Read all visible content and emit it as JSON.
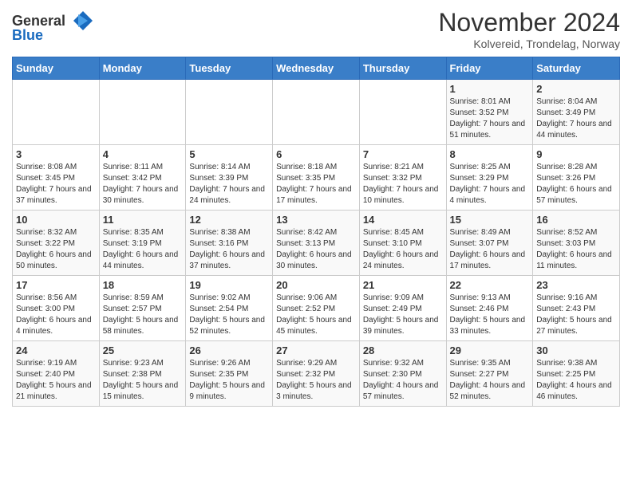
{
  "header": {
    "logo_general": "General",
    "logo_blue": "Blue",
    "month_title": "November 2024",
    "subtitle": "Kolvereid, Trondelag, Norway"
  },
  "weekdays": [
    "Sunday",
    "Monday",
    "Tuesday",
    "Wednesday",
    "Thursday",
    "Friday",
    "Saturday"
  ],
  "weeks": [
    [
      {
        "day": "",
        "info": ""
      },
      {
        "day": "",
        "info": ""
      },
      {
        "day": "",
        "info": ""
      },
      {
        "day": "",
        "info": ""
      },
      {
        "day": "",
        "info": ""
      },
      {
        "day": "1",
        "info": "Sunrise: 8:01 AM\nSunset: 3:52 PM\nDaylight: 7 hours and 51 minutes."
      },
      {
        "day": "2",
        "info": "Sunrise: 8:04 AM\nSunset: 3:49 PM\nDaylight: 7 hours and 44 minutes."
      }
    ],
    [
      {
        "day": "3",
        "info": "Sunrise: 8:08 AM\nSunset: 3:45 PM\nDaylight: 7 hours and 37 minutes."
      },
      {
        "day": "4",
        "info": "Sunrise: 8:11 AM\nSunset: 3:42 PM\nDaylight: 7 hours and 30 minutes."
      },
      {
        "day": "5",
        "info": "Sunrise: 8:14 AM\nSunset: 3:39 PM\nDaylight: 7 hours and 24 minutes."
      },
      {
        "day": "6",
        "info": "Sunrise: 8:18 AM\nSunset: 3:35 PM\nDaylight: 7 hours and 17 minutes."
      },
      {
        "day": "7",
        "info": "Sunrise: 8:21 AM\nSunset: 3:32 PM\nDaylight: 7 hours and 10 minutes."
      },
      {
        "day": "8",
        "info": "Sunrise: 8:25 AM\nSunset: 3:29 PM\nDaylight: 7 hours and 4 minutes."
      },
      {
        "day": "9",
        "info": "Sunrise: 8:28 AM\nSunset: 3:26 PM\nDaylight: 6 hours and 57 minutes."
      }
    ],
    [
      {
        "day": "10",
        "info": "Sunrise: 8:32 AM\nSunset: 3:22 PM\nDaylight: 6 hours and 50 minutes."
      },
      {
        "day": "11",
        "info": "Sunrise: 8:35 AM\nSunset: 3:19 PM\nDaylight: 6 hours and 44 minutes."
      },
      {
        "day": "12",
        "info": "Sunrise: 8:38 AM\nSunset: 3:16 PM\nDaylight: 6 hours and 37 minutes."
      },
      {
        "day": "13",
        "info": "Sunrise: 8:42 AM\nSunset: 3:13 PM\nDaylight: 6 hours and 30 minutes."
      },
      {
        "day": "14",
        "info": "Sunrise: 8:45 AM\nSunset: 3:10 PM\nDaylight: 6 hours and 24 minutes."
      },
      {
        "day": "15",
        "info": "Sunrise: 8:49 AM\nSunset: 3:07 PM\nDaylight: 6 hours and 17 minutes."
      },
      {
        "day": "16",
        "info": "Sunrise: 8:52 AM\nSunset: 3:03 PM\nDaylight: 6 hours and 11 minutes."
      }
    ],
    [
      {
        "day": "17",
        "info": "Sunrise: 8:56 AM\nSunset: 3:00 PM\nDaylight: 6 hours and 4 minutes."
      },
      {
        "day": "18",
        "info": "Sunrise: 8:59 AM\nSunset: 2:57 PM\nDaylight: 5 hours and 58 minutes."
      },
      {
        "day": "19",
        "info": "Sunrise: 9:02 AM\nSunset: 2:54 PM\nDaylight: 5 hours and 52 minutes."
      },
      {
        "day": "20",
        "info": "Sunrise: 9:06 AM\nSunset: 2:52 PM\nDaylight: 5 hours and 45 minutes."
      },
      {
        "day": "21",
        "info": "Sunrise: 9:09 AM\nSunset: 2:49 PM\nDaylight: 5 hours and 39 minutes."
      },
      {
        "day": "22",
        "info": "Sunrise: 9:13 AM\nSunset: 2:46 PM\nDaylight: 5 hours and 33 minutes."
      },
      {
        "day": "23",
        "info": "Sunrise: 9:16 AM\nSunset: 2:43 PM\nDaylight: 5 hours and 27 minutes."
      }
    ],
    [
      {
        "day": "24",
        "info": "Sunrise: 9:19 AM\nSunset: 2:40 PM\nDaylight: 5 hours and 21 minutes."
      },
      {
        "day": "25",
        "info": "Sunrise: 9:23 AM\nSunset: 2:38 PM\nDaylight: 5 hours and 15 minutes."
      },
      {
        "day": "26",
        "info": "Sunrise: 9:26 AM\nSunset: 2:35 PM\nDaylight: 5 hours and 9 minutes."
      },
      {
        "day": "27",
        "info": "Sunrise: 9:29 AM\nSunset: 2:32 PM\nDaylight: 5 hours and 3 minutes."
      },
      {
        "day": "28",
        "info": "Sunrise: 9:32 AM\nSunset: 2:30 PM\nDaylight: 4 hours and 57 minutes."
      },
      {
        "day": "29",
        "info": "Sunrise: 9:35 AM\nSunset: 2:27 PM\nDaylight: 4 hours and 52 minutes."
      },
      {
        "day": "30",
        "info": "Sunrise: 9:38 AM\nSunset: 2:25 PM\nDaylight: 4 hours and 46 minutes."
      }
    ]
  ]
}
